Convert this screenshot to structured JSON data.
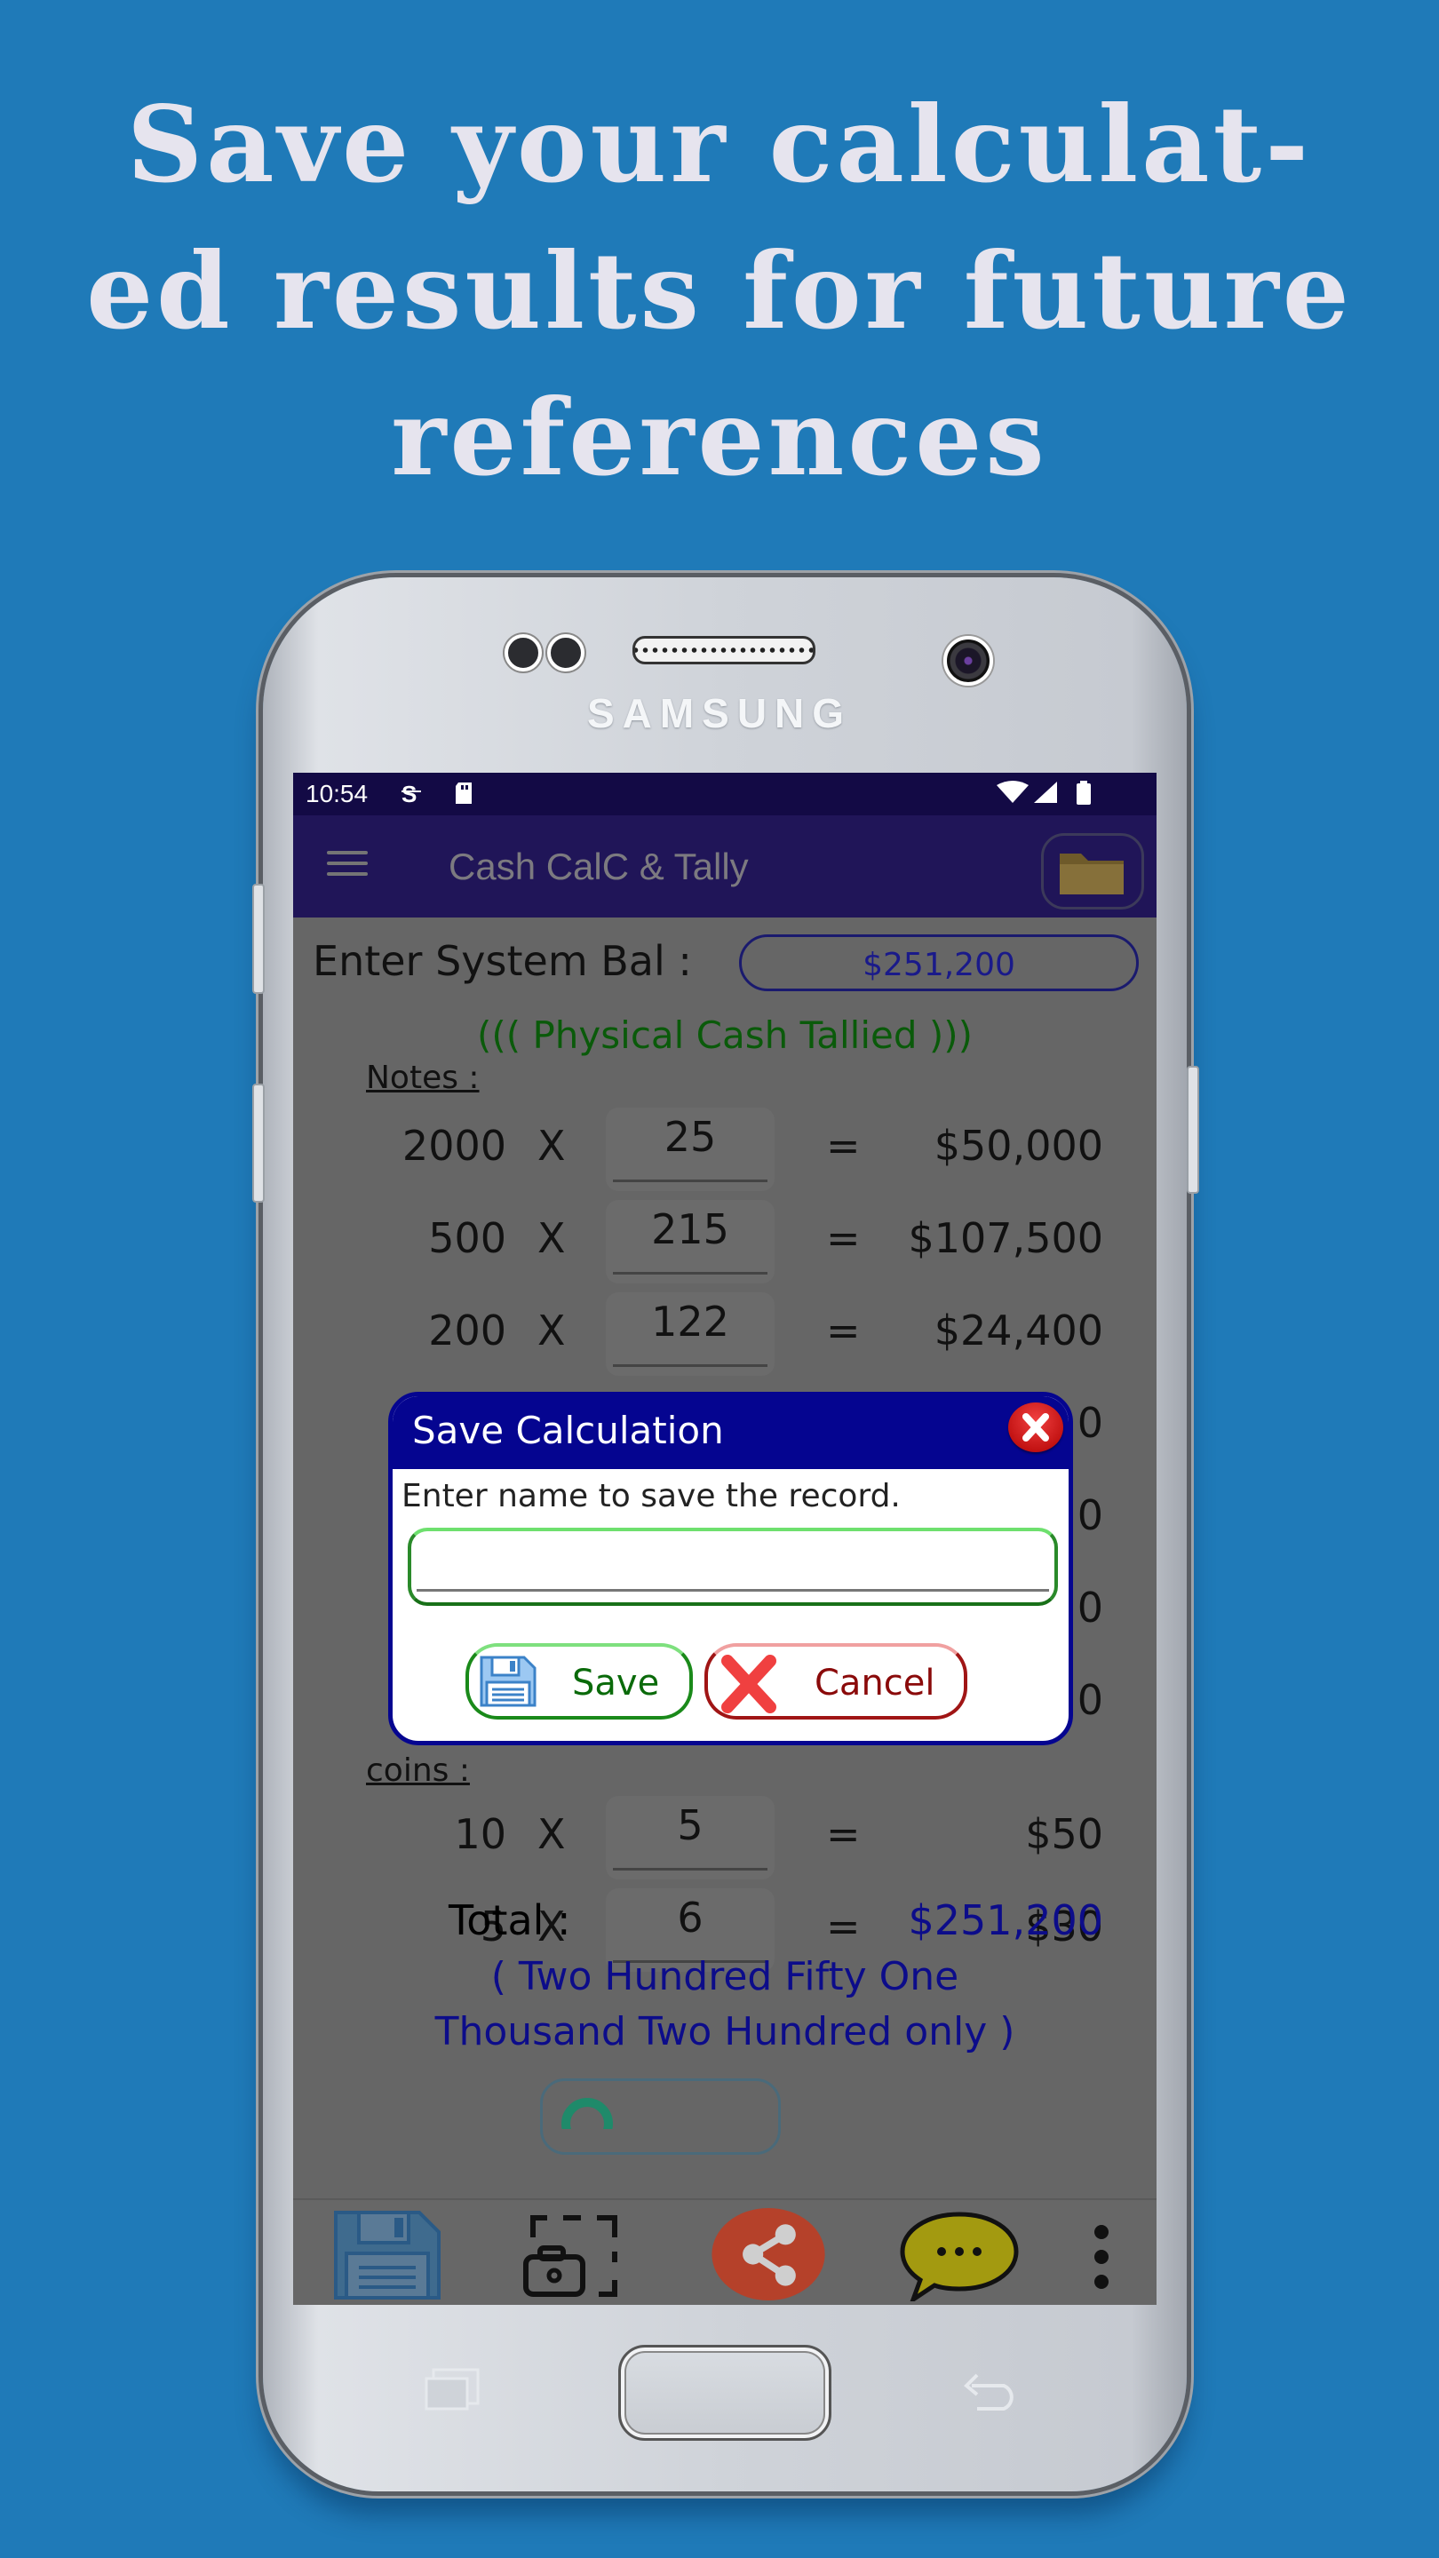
{
  "headline": {
    "lines": [
      "Save your calculat-",
      "ed results for future",
      "references"
    ]
  },
  "device": {
    "brand": "SAMSUNG"
  },
  "status_bar": {
    "time": "10:54",
    "icons": [
      "sync-s-icon",
      "sd-card-icon",
      "wifi-icon",
      "signal-icon",
      "battery-icon"
    ]
  },
  "app_bar": {
    "title": "Cash CalC & Tally",
    "menu_icon": "hamburger-menu-icon",
    "action_icon": "folder-icon"
  },
  "form": {
    "system_balance_label": "Enter System Bal :",
    "system_balance_value": "$251,200",
    "tally_status": "((( Physical Cash Tallied )))",
    "notes_label": "Notes :",
    "notes": [
      {
        "denomination": "2000",
        "times": "X",
        "quantity": "25",
        "equals": "=",
        "amount": "$50,000"
      },
      {
        "denomination": "500",
        "times": "X",
        "quantity": "215",
        "equals": "=",
        "amount": "$107,500"
      },
      {
        "denomination": "200",
        "times": "X",
        "quantity": "122",
        "equals": "=",
        "amount": "$24,400"
      }
    ],
    "hidden_amount_suffixes": [
      "0",
      "0",
      "0",
      "0"
    ],
    "coins_label": "coins :",
    "coins": [
      {
        "denomination": "10",
        "times": "X",
        "quantity": "5",
        "equals": "=",
        "amount": "$50"
      },
      {
        "denomination": "5",
        "times": "X",
        "quantity": "6",
        "equals": "=",
        "amount": "$30"
      }
    ],
    "total_label": "Total :",
    "total_value": "$251,200",
    "total_words_line1": "( Two Hundred Fifty One",
    "total_words_line2": "Thousand Two Hundred  only )"
  },
  "bottom_toolbar": {
    "items": [
      "save-floppy-icon",
      "screenshot-camera-icon",
      "share-icon",
      "chat-bubble-icon",
      "more-vertical-icon"
    ]
  },
  "dialog": {
    "title": "Save Calculation",
    "prompt": "Enter name to save the record.",
    "input_value": "",
    "input_placeholder": "",
    "save_label": "Save",
    "cancel_label": "Cancel"
  },
  "colors": {
    "background": "#1f7ab8",
    "headline_text": "#e6e4ee",
    "status_bar": "#130a45",
    "app_bar": "#201558",
    "dialog_header": "#050590",
    "tally_green": "#0a5a0a",
    "total_blue": "#0c0c8a",
    "save_green": "#1a8a1a",
    "cancel_red": "#a01515"
  }
}
